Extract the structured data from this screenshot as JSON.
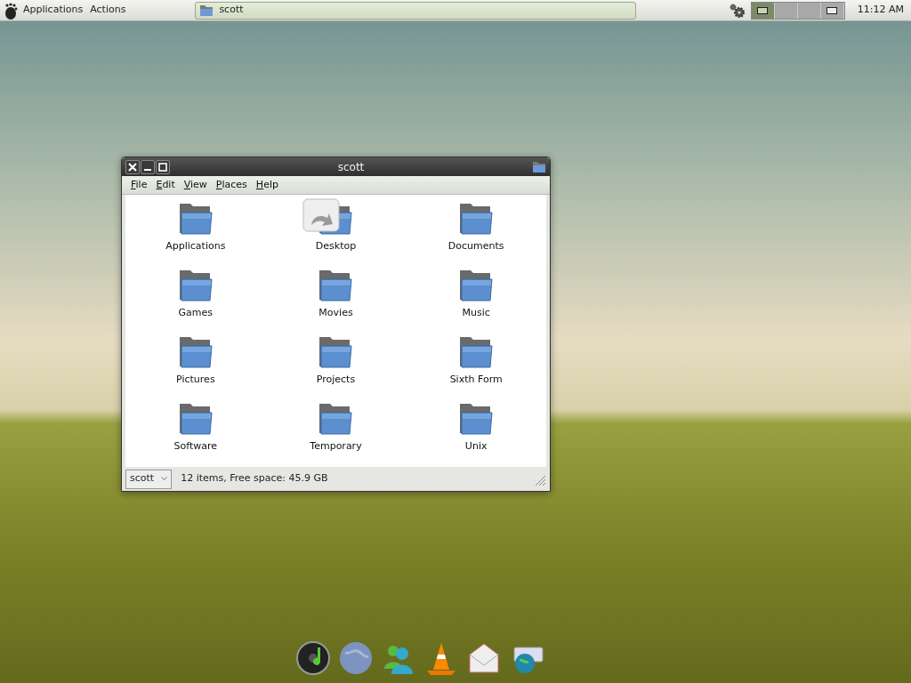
{
  "top_panel": {
    "menus": [
      "Applications",
      "Actions"
    ],
    "taskbar": [
      {
        "label": "scott",
        "selected": true
      }
    ],
    "workspaces": [
      {
        "selected": true,
        "has_window": true
      },
      {
        "selected": false,
        "has_window": false
      },
      {
        "selected": false,
        "has_window": false
      },
      {
        "selected": false,
        "has_window": true
      }
    ],
    "clock": "11:12 AM"
  },
  "window": {
    "title": "scott",
    "menu": [
      "File",
      "Edit",
      "View",
      "Places",
      "Help"
    ],
    "items": [
      "Applications",
      "Desktop",
      "Documents",
      "Games",
      "Movies",
      "Music",
      "Pictures",
      "Projects",
      "Sixth Form",
      "Software",
      "Temporary",
      "Unix"
    ],
    "location": "scott",
    "status": "12 items, Free space: 45.9 GB"
  }
}
